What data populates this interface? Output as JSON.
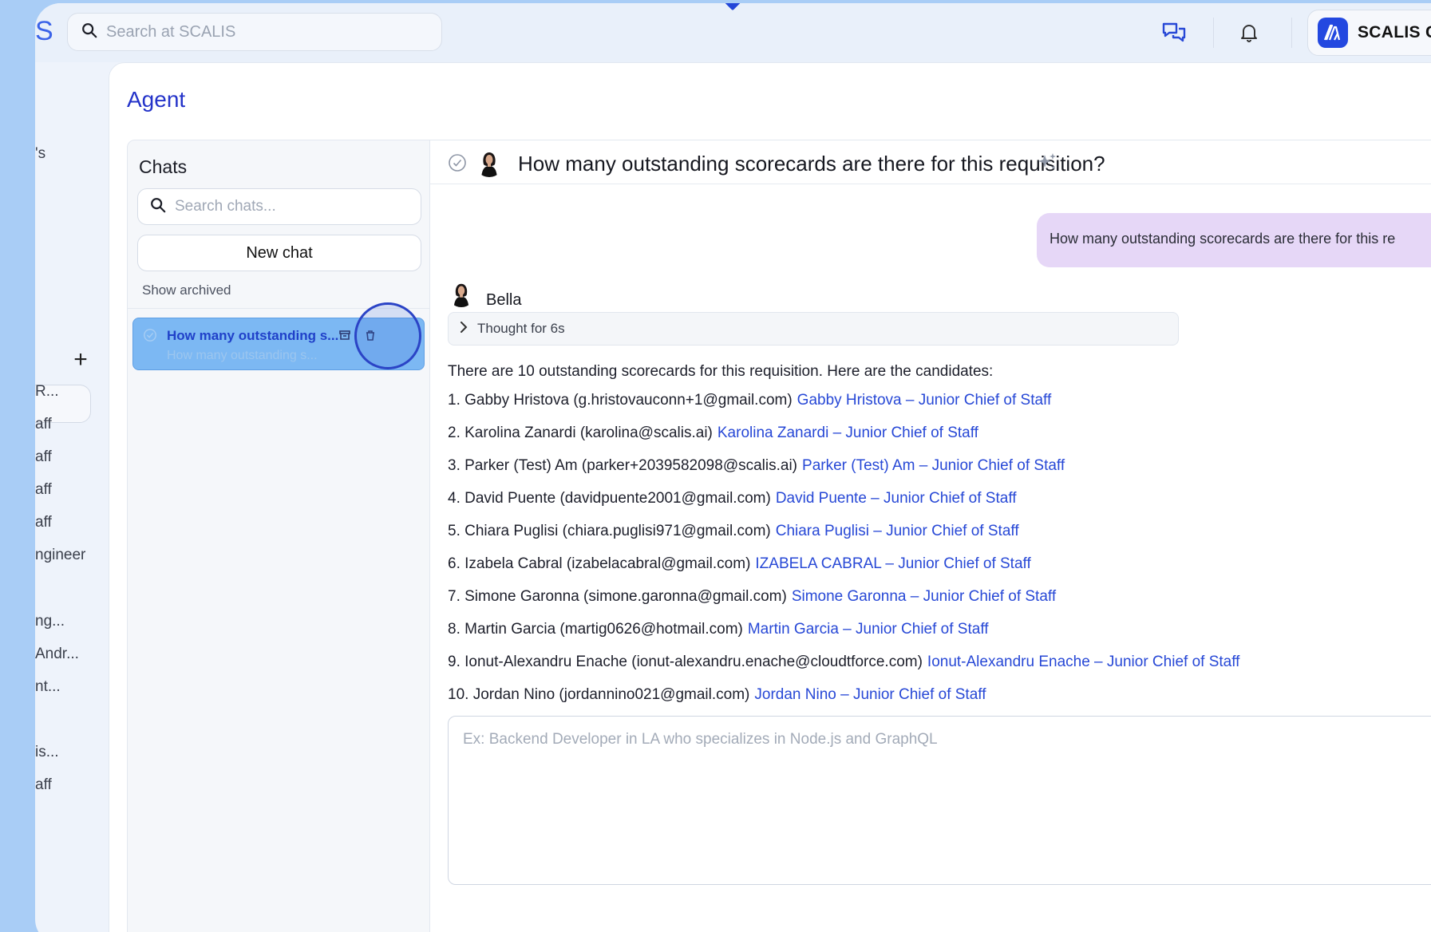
{
  "app": {
    "logo_letter": "S",
    "search_placeholder": "Search at SCALIS",
    "org_name": "SCALIS C"
  },
  "left_nav": {
    "fragments": [
      "'s",
      "R...",
      "aff",
      "aff",
      "aff",
      "aff",
      "ngineer",
      "ng...",
      "Andr...",
      "nt...",
      "is...",
      "aff"
    ]
  },
  "page": {
    "title": "Agent"
  },
  "chat_list": {
    "heading": "Chats",
    "search_placeholder": "Search chats...",
    "new_chat_label": "New chat",
    "show_archived_label": "Show archived",
    "items": [
      {
        "title": "How many outstanding s...",
        "subtitle": "How many outstanding s..."
      }
    ]
  },
  "conversation": {
    "title": "How many outstanding scorecards are there for this requisition?",
    "user_message": "How many outstanding scorecards are there for this re",
    "agent_name": "Bella",
    "thought_label": "Thought for 6s",
    "answer_intro": "There are 10 outstanding scorecards for this requisition. Here are the candidates:",
    "candidates": [
      {
        "text": "1. Gabby Hristova (g.hristovauconn+1@gmail.com)",
        "link": "Gabby Hristova – Junior Chief of Staff"
      },
      {
        "text": "2. Karolina Zanardi (karolina@scalis.ai)",
        "link": "Karolina Zanardi – Junior Chief of Staff"
      },
      {
        "text": "3. Parker (Test) Am (parker+2039582098@scalis.ai)",
        "link": "Parker (Test) Am – Junior Chief of Staff"
      },
      {
        "text": "4. David Puente (davidpuente2001@gmail.com)",
        "link": "David Puente – Junior Chief of Staff"
      },
      {
        "text": "5. Chiara Puglisi (chiara.puglisi971@gmail.com)",
        "link": "Chiara Puglisi – Junior Chief of Staff"
      },
      {
        "text": "6. Izabela Cabral (izabelacabral@gmail.com)",
        "link": "IZABELA CABRAL – Junior Chief of Staff"
      },
      {
        "text": "7. Simone Garonna (simone.garonna@gmail.com)",
        "link": "Simone Garonna – Junior Chief of Staff"
      },
      {
        "text": "8. Martin Garcia (martig0626@hotmail.com)",
        "link": "Martin Garcia – Junior Chief of Staff"
      },
      {
        "text": "9. Ionut-Alexandru Enache (ionut-alexandru.enache@cloudtforce.com)",
        "link": "Ionut-Alexandru Enache – Junior Chief of Staff"
      },
      {
        "text": "10. Jordan Nino (jordannino021@gmail.com)",
        "link": "Jordan Nino – Junior Chief of Staff"
      }
    ],
    "composer_placeholder": "Ex: Backend Developer in LA who specializes in Node.js and GraphQL"
  },
  "icons": {
    "search": "search-icon",
    "chat_bubbles": "chat-bubbles-icon",
    "bell": "bell-icon",
    "org_logo": "scalis-logo-icon",
    "check_circle": "check-circle-icon",
    "sparkle": "sparkle-icon",
    "chevron_right": "chevron-right-icon",
    "archive": "archive-icon",
    "trash": "trash-icon",
    "plus": "plus-icon"
  },
  "colors": {
    "accent": "#2748d6",
    "selected_chat_bg": "#7cb8f3",
    "user_bubble_bg": "#e6d7f7",
    "outer_bg": "#a9cdf6"
  }
}
